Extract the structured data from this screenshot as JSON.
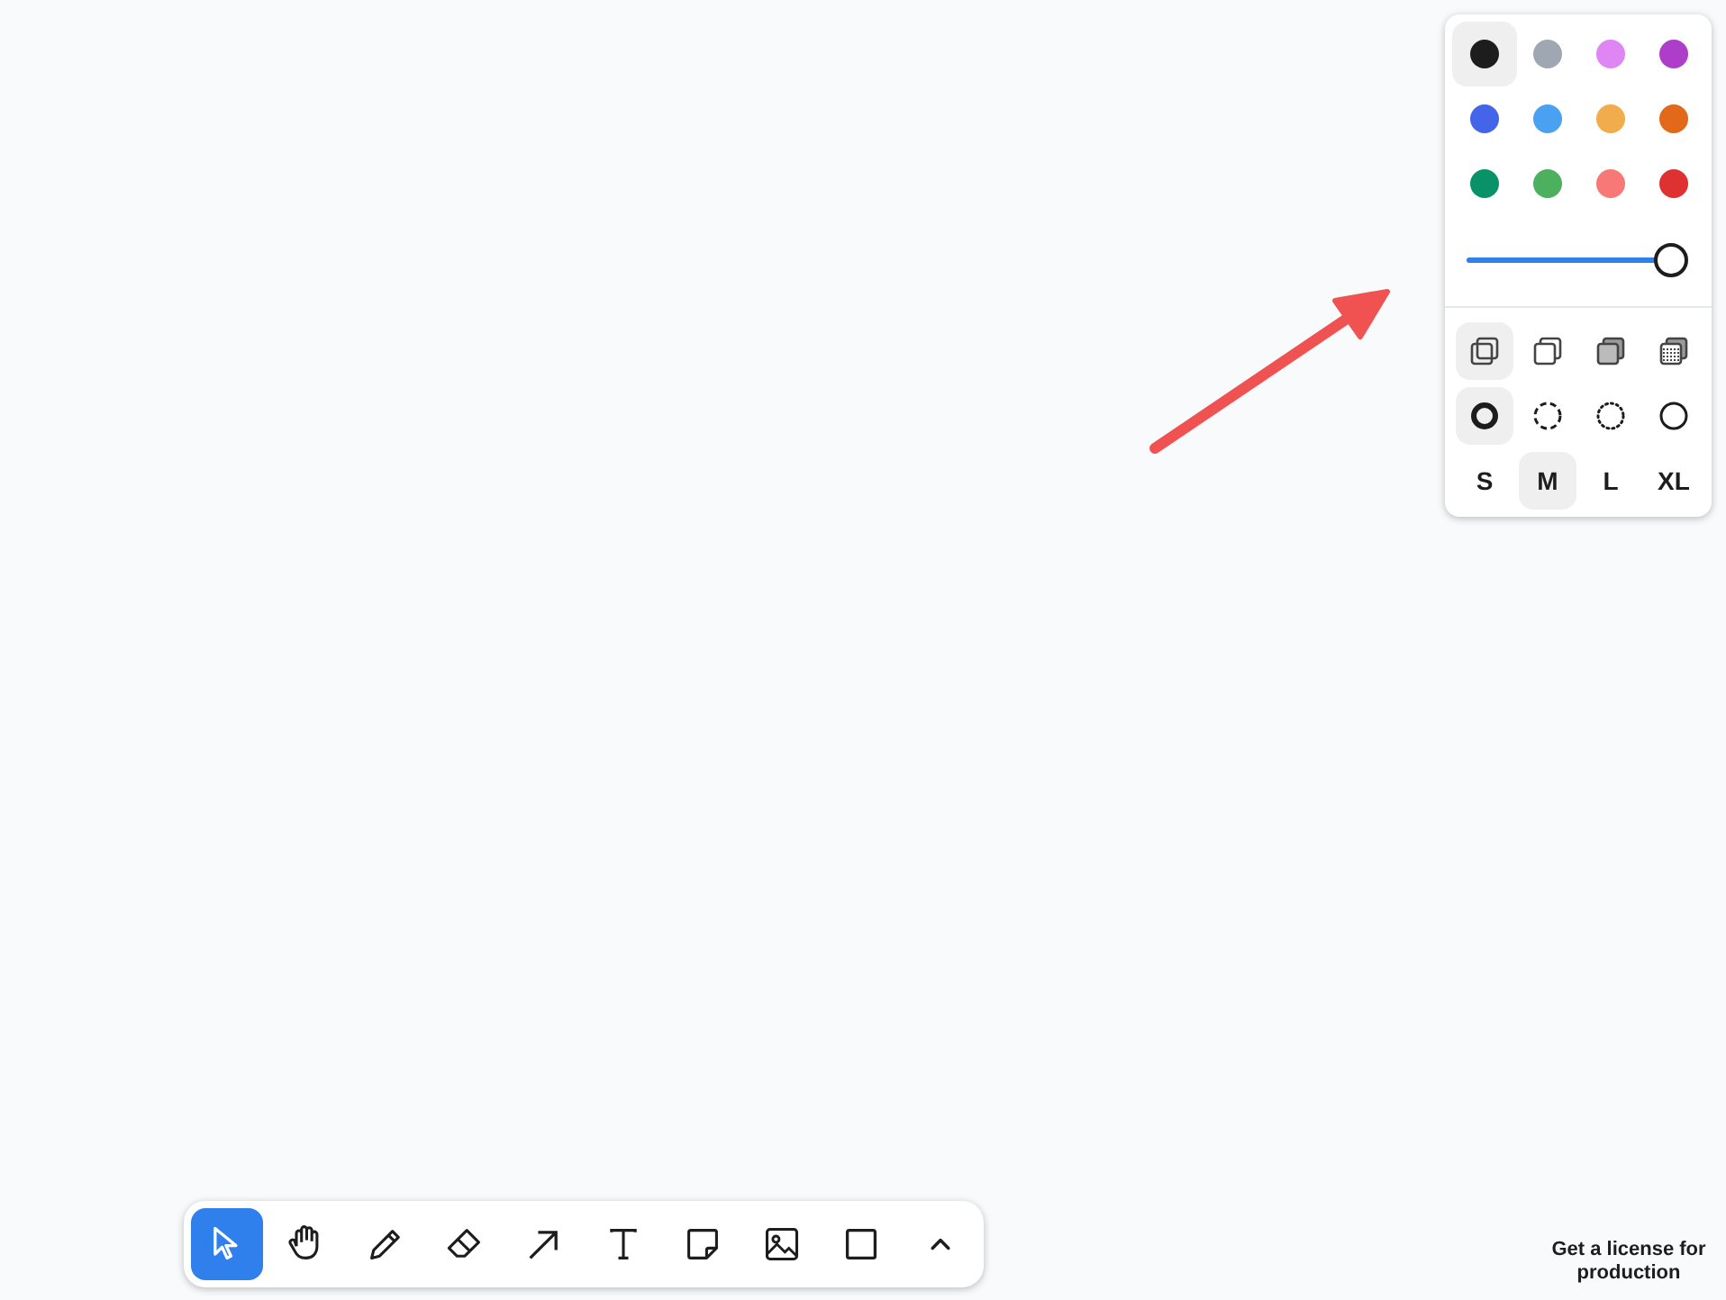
{
  "style_panel": {
    "colors": [
      {
        "color": "#1d1d1d",
        "selected": true
      },
      {
        "color": "#9fa8b2",
        "selected": false
      },
      {
        "color": "#e085f4",
        "selected": false
      },
      {
        "color": "#ae3ec9",
        "selected": false
      },
      {
        "color": "#4465e9",
        "selected": false
      },
      {
        "color": "#4ba1f1",
        "selected": false
      },
      {
        "color": "#f1ac4b",
        "selected": false
      },
      {
        "color": "#e16919",
        "selected": false
      },
      {
        "color": "#099268",
        "selected": false
      },
      {
        "color": "#4cb05e",
        "selected": false
      },
      {
        "color": "#f87777",
        "selected": false
      },
      {
        "color": "#e03131",
        "selected": false
      }
    ],
    "opacity": {
      "level": 1
    },
    "fills": [
      {
        "kind": "none",
        "selected": true
      },
      {
        "kind": "semi",
        "selected": false
      },
      {
        "kind": "solid",
        "selected": false
      },
      {
        "kind": "pattern",
        "selected": false
      }
    ],
    "dashes": [
      {
        "kind": "draw",
        "selected": true
      },
      {
        "kind": "dashed",
        "selected": false
      },
      {
        "kind": "dotted",
        "selected": false
      },
      {
        "kind": "solid",
        "selected": false
      }
    ],
    "sizes": [
      {
        "label": "S",
        "selected": false
      },
      {
        "label": "M",
        "selected": true
      },
      {
        "label": "L",
        "selected": false
      },
      {
        "label": "XL",
        "selected": false
      }
    ]
  },
  "canvas": {
    "shapes": [
      {
        "kind": "arrow",
        "color": "#f05252"
      }
    ]
  },
  "toolbar": [
    {
      "kind": "select",
      "selected": true
    },
    {
      "kind": "hand",
      "selected": false
    },
    {
      "kind": "draw",
      "selected": false
    },
    {
      "kind": "eraser",
      "selected": false
    },
    {
      "kind": "arrow",
      "selected": false
    },
    {
      "kind": "text",
      "selected": false
    },
    {
      "kind": "note",
      "selected": false
    },
    {
      "kind": "image",
      "selected": false
    },
    {
      "kind": "rectangle",
      "selected": false
    },
    {
      "kind": "more",
      "selected": false
    }
  ],
  "license_link": "Get a license for production"
}
